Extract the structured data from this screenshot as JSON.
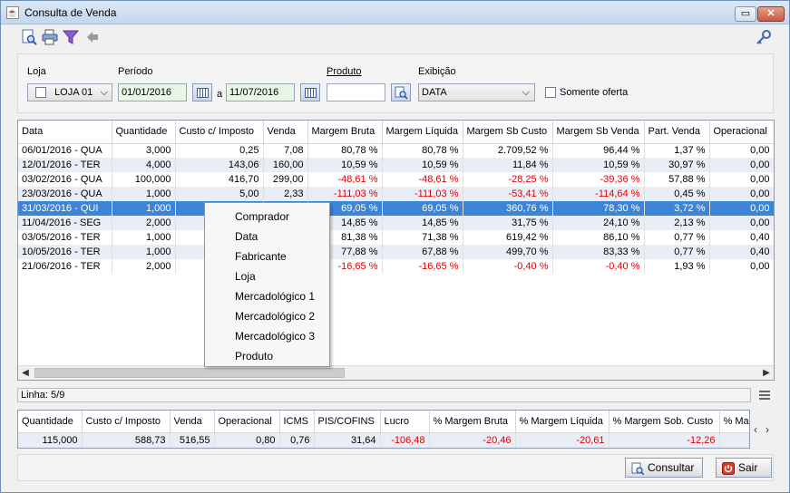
{
  "window": {
    "title": "Consulta de Venda",
    "app_icon_glyph": "☕",
    "restore_glyph": "▭",
    "close_glyph": "✕"
  },
  "toolbar": {
    "icons": [
      "search-doc-icon",
      "print-icon",
      "filter-icon",
      "back-arrow-icon",
      "key-icon"
    ]
  },
  "filters": {
    "loja_label": "Loja",
    "loja_value": "LOJA 01",
    "periodo_label": "Período",
    "date_from": "01/01/2016",
    "date_sep": "a",
    "date_to": "11/07/2016",
    "produto_label": "Produto",
    "produto_value": "",
    "exibicao_label": "Exibição",
    "exibicao_value": "DATA",
    "somente_oferta_label": "Somente oferta"
  },
  "grid": {
    "columns": [
      "Data",
      "Quantidade",
      "Custo c/ Imposto",
      "Venda",
      "Margem Bruta",
      "Margem Líquida",
      "Margem Sb Custo",
      "Margem Sb Venda",
      "Part. Venda",
      "Operacional"
    ],
    "rows": [
      [
        "06/01/2016 - QUA",
        "3,000",
        "0,25",
        "7,08",
        "80,78 %",
        "80,78 %",
        "2.709,52 %",
        "96,44 %",
        "1,37 %",
        "0,00"
      ],
      [
        "12/01/2016 - TER",
        "4,000",
        "143,06",
        "160,00",
        "10,59 %",
        "10,59 %",
        "11,84 %",
        "10,59 %",
        "30,97 %",
        "0,00"
      ],
      [
        "03/02/2016 - QUA",
        "100,000",
        "416,70",
        "299,00",
        "-48,61 %",
        "-48,61 %",
        "-28,25 %",
        "-39,36 %",
        "57,88 %",
        "0,00"
      ],
      [
        "23/03/2016 - QUA",
        "1,000",
        "5,00",
        "2,33",
        "-111,03 %",
        "-111,03 %",
        "-53,41 %",
        "-114,64 %",
        "0,45 %",
        "0,00"
      ],
      [
        "31/03/2016 - QUI",
        "1,000",
        "",
        "",
        "69,05 %",
        "69,05 %",
        "360,76 %",
        "78,30 %",
        "3,72 %",
        "0,00"
      ],
      [
        "11/04/2016 - SEG",
        "2,000",
        "",
        "",
        "14,85 %",
        "14,85 %",
        "31,75 %",
        "24,10 %",
        "2,13 %",
        "0,00"
      ],
      [
        "03/05/2016 - TER",
        "1,000",
        "",
        "",
        "81,38 %",
        "71,38 %",
        "619,42 %",
        "86,10 %",
        "0,77 %",
        "0,40"
      ],
      [
        "10/05/2016 - TER",
        "1,000",
        "",
        "",
        "77,88 %",
        "67,88 %",
        "499,70 %",
        "83,33 %",
        "0,77 %",
        "0,40"
      ],
      [
        "21/06/2016 - TER",
        "2,000",
        "",
        "",
        "-16,65 %",
        "-16,65 %",
        "-0,40 %",
        "-0,40 %",
        "1,93 %",
        "0,00"
      ]
    ],
    "selected_row": 4,
    "scroll_left_glyph": "◀",
    "scroll_right_glyph": "▶"
  },
  "context_menu": {
    "items": [
      "Comprador",
      "Data",
      "Fabricante",
      "Loja",
      "Mercadológico 1",
      "Mercadológico 2",
      "Mercadológico 3",
      "Produto"
    ]
  },
  "status": {
    "linha": "Linha: 5/9"
  },
  "totals": {
    "columns": [
      "Quantidade",
      "Custo c/ Imposto",
      "Venda",
      "Operacional",
      "ICMS",
      "PIS/COFINS",
      "Lucro",
      "% Margem Bruta",
      "% Margem Líquida",
      "% Margem Sob. Custo",
      "% Ma"
    ],
    "values": [
      "115,000",
      "588,73",
      "516,55",
      "0,80",
      "0,76",
      "31,64",
      "-106,48",
      "-20,46",
      "-20,61",
      "-12,26",
      ""
    ],
    "nav_prev_glyph": "‹",
    "nav_next_glyph": "›"
  },
  "buttons": {
    "consultar": "Consultar",
    "sair": "Sair"
  },
  "colors": {
    "selection": "#3c84d6",
    "negative": "#e00000",
    "alt_row": "#e9eef6"
  }
}
